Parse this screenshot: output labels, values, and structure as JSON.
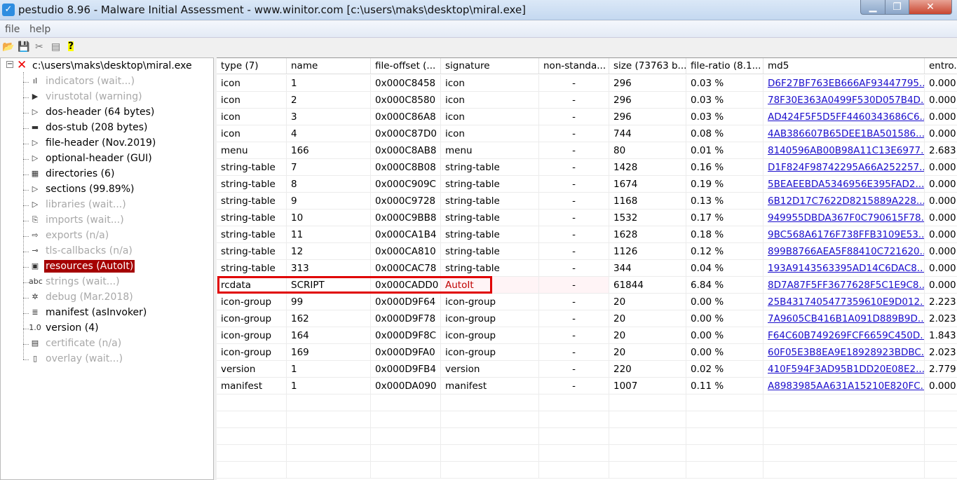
{
  "window": {
    "title": "pestudio 8.96 - Malware Initial Assessment - www.winitor.com [c:\\users\\maks\\desktop\\miral.exe]",
    "min": "▁",
    "max": "❐",
    "close": "✕"
  },
  "menu": {
    "file": "file",
    "help": "help"
  },
  "toolbar": {
    "open": "📂",
    "save": "💾",
    "cut": "✂",
    "copy": "▤",
    "help": "?"
  },
  "tree": {
    "root": "c:\\users\\maks\\desktop\\miral.exe",
    "items": [
      {
        "label": "indicators (wait...)",
        "icon": "ıl",
        "dim": true
      },
      {
        "label": "virustotal (warning)",
        "icon": "▶",
        "dim": true
      },
      {
        "label": "dos-header (64 bytes)",
        "icon": "▷",
        "dim": false
      },
      {
        "label": "dos-stub (208 bytes)",
        "icon": "▬",
        "dim": false
      },
      {
        "label": "file-header (Nov.2019)",
        "icon": "▷",
        "dim": false
      },
      {
        "label": "optional-header (GUI)",
        "icon": "▷",
        "dim": false
      },
      {
        "label": "directories (6)",
        "icon": "▦",
        "dim": false
      },
      {
        "label": "sections (99.89%)",
        "icon": "▷",
        "dim": false
      },
      {
        "label": "libraries (wait...)",
        "icon": "▷",
        "dim": true
      },
      {
        "label": "imports (wait...)",
        "icon": "⎘",
        "dim": true
      },
      {
        "label": "exports (n/a)",
        "icon": "⇨",
        "dim": true
      },
      {
        "label": "tls-callbacks (n/a)",
        "icon": "⊸",
        "dim": true
      },
      {
        "label": "resources (AutoIt)",
        "icon": "▣",
        "dim": false,
        "selected": true
      },
      {
        "label": "strings (wait...)",
        "icon": "abc",
        "dim": true
      },
      {
        "label": "debug (Mar.2018)",
        "icon": "✲",
        "dim": true
      },
      {
        "label": "manifest (asInvoker)",
        "icon": "≣",
        "dim": false
      },
      {
        "label": "version (4)",
        "icon": "1.0",
        "dim": false
      },
      {
        "label": "certificate (n/a)",
        "icon": "▤",
        "dim": true
      },
      {
        "label": "overlay (wait...)",
        "icon": "▯",
        "dim": true
      }
    ]
  },
  "table": {
    "headers": [
      "type (7)",
      "name",
      "file-offset (...",
      "signature",
      "non-standa...",
      "size (73763 b...",
      "file-ratio (8.1...",
      "md5",
      "entro..."
    ],
    "rows": [
      [
        "icon",
        "1",
        "0x000C8458",
        "icon",
        "-",
        "296",
        "0.03 %",
        "D6F27BF763EB666AF93447795...",
        "0.000"
      ],
      [
        "icon",
        "2",
        "0x000C8580",
        "icon",
        "-",
        "296",
        "0.03 %",
        "78F30E363A0499F530D057B4D...",
        "0.000"
      ],
      [
        "icon",
        "3",
        "0x000C86A8",
        "icon",
        "-",
        "296",
        "0.03 %",
        "AD424F5F5D5FF4460343686C6...",
        "0.000"
      ],
      [
        "icon",
        "4",
        "0x000C87D0",
        "icon",
        "-",
        "744",
        "0.08 %",
        "4AB386607B65DEE1BA501586...",
        "0.000"
      ],
      [
        "menu",
        "166",
        "0x000C8AB8",
        "menu",
        "-",
        "80",
        "0.01 %",
        "8140596AB00B98A11C13E6977...",
        "2.683"
      ],
      [
        "string-table",
        "7",
        "0x000C8B08",
        "string-table",
        "-",
        "1428",
        "0.16 %",
        "D1F824F98742295A66A252257...",
        "0.000"
      ],
      [
        "string-table",
        "8",
        "0x000C909C",
        "string-table",
        "-",
        "1674",
        "0.19 %",
        "5BEAEEBDA5346956E395FAD2...",
        "0.000"
      ],
      [
        "string-table",
        "9",
        "0x000C9728",
        "string-table",
        "-",
        "1168",
        "0.13 %",
        "6B12D17C7622D8215889A228...",
        "0.000"
      ],
      [
        "string-table",
        "10",
        "0x000C9BB8",
        "string-table",
        "-",
        "1532",
        "0.17 %",
        "949955DBDA367F0C790615F78...",
        "0.000"
      ],
      [
        "string-table",
        "11",
        "0x000CA1B4",
        "string-table",
        "-",
        "1628",
        "0.18 %",
        "9BC568A6176F738FFB3109E53...",
        "0.000"
      ],
      [
        "string-table",
        "12",
        "0x000CA810",
        "string-table",
        "-",
        "1126",
        "0.12 %",
        "899B8766AEA5F88410C721620...",
        "0.000"
      ],
      [
        "string-table",
        "313",
        "0x000CAC78",
        "string-table",
        "-",
        "344",
        "0.04 %",
        "193A9143563395AD14C6DAC8...",
        "0.000"
      ],
      [
        "rcdata",
        "SCRIPT",
        "0x000CADD0",
        "AutoIt",
        "-",
        "61844",
        "6.84 %",
        "8D7A87F5FF3677628F5C1E9C8...",
        "0.000"
      ],
      [
        "icon-group",
        "99",
        "0x000D9F64",
        "icon-group",
        "-",
        "20",
        "0.00 %",
        "25B4317405477359610E9D012...",
        "2.223"
      ],
      [
        "icon-group",
        "162",
        "0x000D9F78",
        "icon-group",
        "-",
        "20",
        "0.00 %",
        "7A9605CB416B1A091D889B9D...",
        "2.023"
      ],
      [
        "icon-group",
        "164",
        "0x000D9F8C",
        "icon-group",
        "-",
        "20",
        "0.00 %",
        "F64C60B749269FCF6659C450D...",
        "1.843"
      ],
      [
        "icon-group",
        "169",
        "0x000D9FA0",
        "icon-group",
        "-",
        "20",
        "0.00 %",
        "60F05E3B8EA9E18928923BDBC...",
        "2.023"
      ],
      [
        "version",
        "1",
        "0x000D9FB4",
        "version",
        "-",
        "220",
        "0.02 %",
        "410F594F3AD95B1DD20E08E2...",
        "2.779"
      ],
      [
        "manifest",
        "1",
        "0x000DA090",
        "manifest",
        "-",
        "1007",
        "0.11 %",
        "A8983985AA631A15210E820FC...",
        "0.000"
      ]
    ]
  },
  "colors": {
    "selected": "#a50000",
    "highlight": "#e00000",
    "link": "#1a0dcc",
    "autoit": "#c00000"
  }
}
